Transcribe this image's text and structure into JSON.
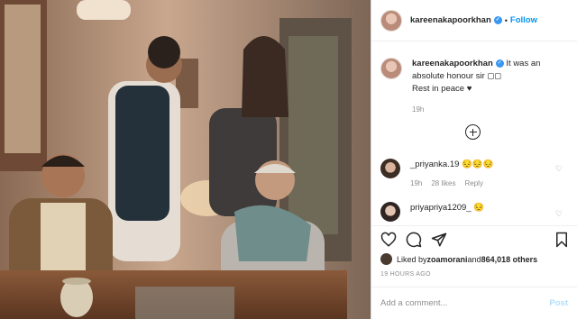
{
  "post": {
    "username": "kareenakapoorkhan",
    "verified_mark": "✓",
    "separator": "•",
    "follow_label": "Follow",
    "caption_username": "kareenakapoorkhan",
    "caption_text": " It was an absolute honour sir ◻◻",
    "caption_line2": "Rest in peace ♥",
    "caption_time": "19h",
    "load_more_icon": "plus-circle-icon"
  },
  "comments": [
    {
      "username": "_priyanka.19",
      "text": " 😔😔😔",
      "time": "19h",
      "likes": "28 likes",
      "reply": "Reply"
    },
    {
      "username": "priyapriya1209_",
      "text": " 😔",
      "time": "",
      "likes": "",
      "reply": ""
    }
  ],
  "actions": {
    "icons": [
      "heart-icon",
      "comment-icon",
      "share-icon",
      "bookmark-icon"
    ]
  },
  "likes": {
    "prefix": "Liked by ",
    "user": "zoamorani",
    "middle": " and ",
    "count": "864,018 others"
  },
  "posted_ago": "19 HOURS AGO",
  "comment_box": {
    "placeholder": "Add a comment...",
    "post_label": "Post"
  },
  "colors": {
    "accent": "#0095f6",
    "post_disabled": "#b2dffc",
    "muted": "#8e8e8e"
  }
}
